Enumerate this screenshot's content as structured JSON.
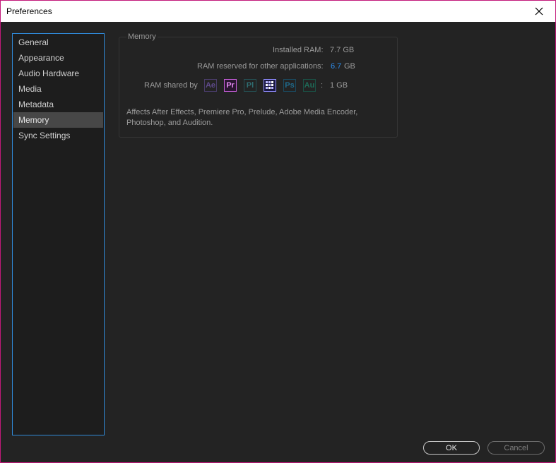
{
  "window": {
    "title": "Preferences"
  },
  "sidebar": {
    "items": [
      {
        "label": "General"
      },
      {
        "label": "Appearance"
      },
      {
        "label": "Audio Hardware"
      },
      {
        "label": "Media"
      },
      {
        "label": "Metadata"
      },
      {
        "label": "Memory",
        "selected": true
      },
      {
        "label": "Sync Settings"
      }
    ]
  },
  "memory": {
    "group_title": "Memory",
    "installed_label": "Installed RAM:",
    "installed_value": "7.7 GB",
    "reserved_label": "RAM reserved for other applications:",
    "reserved_value": "6.7",
    "reserved_unit": "GB",
    "shared_label": "RAM shared by",
    "shared_sep": ":",
    "shared_value": "1 GB",
    "apps": [
      {
        "abbr": "Ae",
        "icon": "after-effects-icon",
        "color": "#5e4a8a"
      },
      {
        "abbr": "Pr",
        "icon": "premiere-pro-icon",
        "color": "#d36ee6"
      },
      {
        "abbr": "Pl",
        "icon": "prelude-icon",
        "color": "#2f6e73"
      },
      {
        "abbr": "",
        "icon": "media-encoder-icon",
        "color": "#8f8cff"
      },
      {
        "abbr": "Ps",
        "icon": "photoshop-icon",
        "color": "#1f6c8f"
      },
      {
        "abbr": "Au",
        "icon": "audition-icon",
        "color": "#1f6b58"
      }
    ],
    "description": "Affects After Effects, Premiere Pro, Prelude, Adobe Media Encoder, Photoshop, and Audition."
  },
  "buttons": {
    "ok": "OK",
    "cancel": "Cancel"
  },
  "colors": {
    "accent": "#2f8ad9",
    "value_blue": "#2d8ceb",
    "border": "#c2197a"
  }
}
